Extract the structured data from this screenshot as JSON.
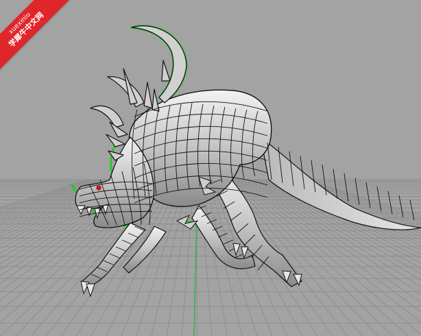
{
  "viewport": {
    "background": "#a3a3a3",
    "grid_color": "#8e8e8e",
    "axis_y_color": "#2fb84a",
    "outline_color": "#22cc22"
  },
  "model": {
    "surface_fill": "#cfcfcf",
    "isocurve_color": "#111111",
    "highlight_point_color": "#e01010"
  },
  "watermark": {
    "line1": "xuexiniu",
    "line2": "学犀牛中文网",
    "color": "#e0262a"
  }
}
